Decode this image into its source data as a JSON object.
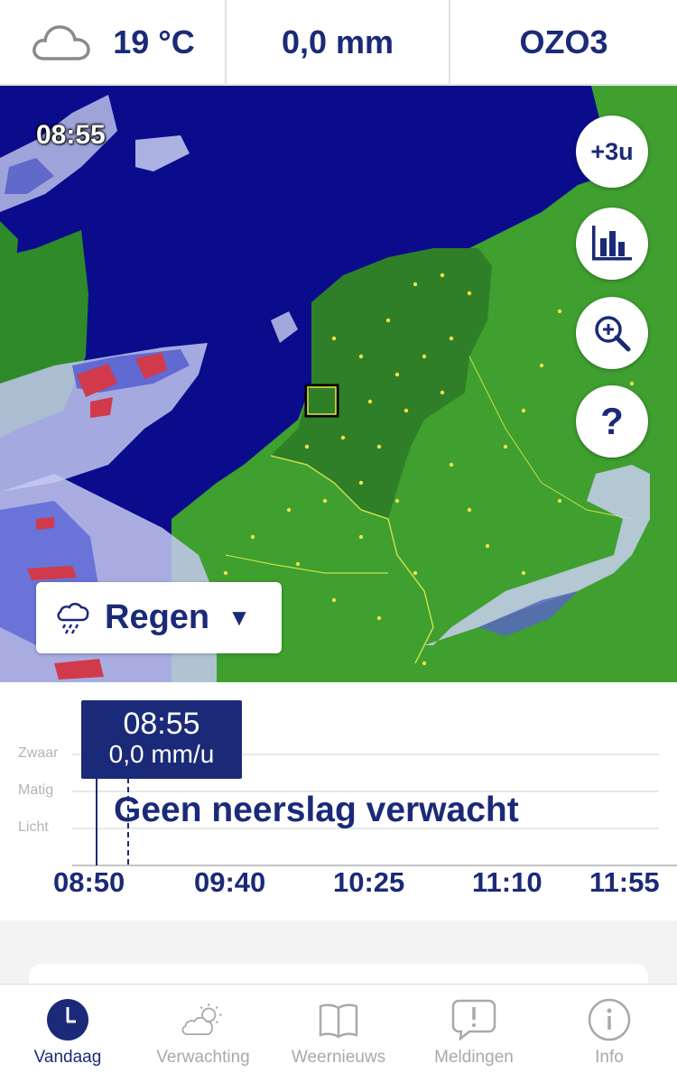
{
  "header": {
    "temperature": "19 °C",
    "precipitation": "0,0 mm",
    "ozone": "OZO3",
    "weather_icon": "cloud-icon"
  },
  "map": {
    "time": "08:55",
    "buttons": {
      "forecast_label": "+3u",
      "chart_icon": "bar-chart-icon",
      "zoom_icon": "zoom-in-icon",
      "help_label": "?"
    },
    "layer": {
      "label": "Regen",
      "icon": "rain-cloud-icon",
      "caret": "▼"
    }
  },
  "precipitation_chart": {
    "tooltip_time": "08:55",
    "tooltip_value": "0,0 mm/u",
    "y_labels": [
      "Zwaar",
      "Matig",
      "Licht"
    ],
    "message": "Geen neerslag verwacht",
    "x_ticks": [
      "08:50",
      "09:40",
      "10:25",
      "11:10",
      "11:55"
    ]
  },
  "colors": {
    "brand": "#1b2a78",
    "sea": "#0a0c8c",
    "land": "#3f9f2f",
    "inactive": "#a9a9a9"
  },
  "nav": {
    "items": [
      {
        "label": "Vandaag",
        "icon": "clock-icon",
        "active": true
      },
      {
        "label": "Verwachting",
        "icon": "sun-cloud-icon",
        "active": false
      },
      {
        "label": "Weernieuws",
        "icon": "book-icon",
        "active": false
      },
      {
        "label": "Meldingen",
        "icon": "alert-bubble-icon",
        "active": false
      },
      {
        "label": "Info",
        "icon": "info-icon",
        "active": false
      }
    ]
  }
}
